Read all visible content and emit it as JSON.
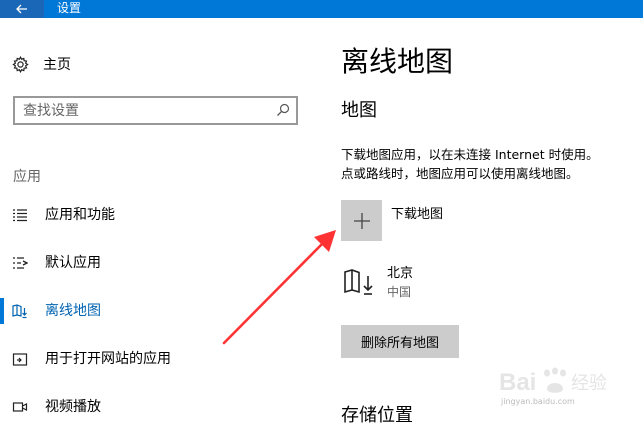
{
  "titlebar": {
    "title": "设置",
    "back_icon": "arrow-left-icon"
  },
  "sidebar": {
    "home_label": "主页",
    "home_icon": "gear-icon",
    "search": {
      "placeholder": "查找设置",
      "value": "",
      "icon": "search-icon"
    },
    "section_label": "应用",
    "items": [
      {
        "label": "应用和功能",
        "icon": "list-icon",
        "active": false
      },
      {
        "label": "默认应用",
        "icon": "default-list-icon",
        "active": false
      },
      {
        "label": "离线地图",
        "icon": "map-download-icon",
        "active": true
      },
      {
        "label": "用于打开网站的应用",
        "icon": "open-in-app-icon",
        "active": false
      },
      {
        "label": "视频播放",
        "icon": "video-icon",
        "active": false
      }
    ],
    "accent_color": "#0078d7"
  },
  "main": {
    "title": "离线地图",
    "section_heading": "地图",
    "description_line1": "下载地图应用，以在未连接 Internet 时使用。",
    "description_line2": "点或路线时，地图应用可以使用离线地图。",
    "add_map_label": "下载地图",
    "add_map_icon": "plus-icon",
    "maps": [
      {
        "city": "北京",
        "country": "中国",
        "icon": "map-download-icon"
      }
    ],
    "delete_all_label": "删除所有地图",
    "storage_heading": "存储位置"
  },
  "watermark": {
    "brand": "Bai",
    "brand_cn": "经验",
    "url": "jingyan.baidu.com"
  }
}
